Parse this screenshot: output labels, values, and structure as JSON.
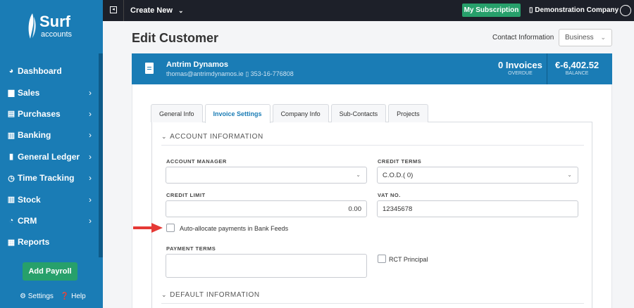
{
  "brand": {
    "name": "Surf",
    "sub": "accounts"
  },
  "sidebar": {
    "items": [
      {
        "label": "Dashboard",
        "icon": "dashboard-icon",
        "glyph": "◕",
        "has_chevron": false
      },
      {
        "label": "Sales",
        "icon": "briefcase-icon",
        "glyph": "▆",
        "has_chevron": true
      },
      {
        "label": "Purchases",
        "icon": "cart-icon",
        "glyph": "▤",
        "has_chevron": true
      },
      {
        "label": "Banking",
        "icon": "bank-icon",
        "glyph": "▥",
        "has_chevron": true
      },
      {
        "label": "General Ledger",
        "icon": "book-icon",
        "glyph": "▮",
        "has_chevron": true
      },
      {
        "label": "Time Tracking",
        "icon": "clock-icon",
        "glyph": "◷",
        "has_chevron": true
      },
      {
        "label": "Stock",
        "icon": "stock-chart-icon",
        "glyph": "▥",
        "has_chevron": true
      },
      {
        "label": "CRM",
        "icon": "pie-chart-icon",
        "glyph": "◔",
        "has_chevron": true
      },
      {
        "label": "Reports",
        "icon": "table-icon",
        "glyph": "▦",
        "has_chevron": false
      }
    ],
    "payroll_button": "Add Payroll",
    "settings_label": "Settings",
    "help_label": "Help"
  },
  "topbar": {
    "create_new": "Create New",
    "subscription_button": "My Subscription",
    "company": "Demonstration Company"
  },
  "page": {
    "title": "Edit Customer",
    "contact_info_label": "Contact Information",
    "contact_info_value": "Business"
  },
  "customer": {
    "name": "Antrim Dynamos",
    "email": "thomas@antrimdynamos.ie",
    "phone": "353-16-776808",
    "invoices_value": "0 Invoices",
    "invoices_caption": "OVERDUE",
    "balance_value": "€-6,402.52",
    "balance_caption": "BALANCE"
  },
  "tabs": [
    {
      "label": "General Info",
      "active": false
    },
    {
      "label": "Invoice Settings",
      "active": true
    },
    {
      "label": "Company Info",
      "active": false
    },
    {
      "label": "Sub-Contacts",
      "active": false
    },
    {
      "label": "Projects",
      "active": false
    }
  ],
  "account_section": {
    "title": "ACCOUNT INFORMATION",
    "account_manager_label": "ACCOUNT MANAGER",
    "account_manager_value": "",
    "credit_terms_label": "CREDIT TERMS",
    "credit_terms_value": "C.O.D.( 0)",
    "credit_limit_label": "CREDIT LIMIT",
    "credit_limit_value": "0.00",
    "vat_label": "VAT NO.",
    "vat_value": "12345678",
    "auto_allocate_label": "Auto-allocate payments in Bank Feeds",
    "auto_allocate_checked": false,
    "payment_terms_label": "PAYMENT TERMS",
    "payment_terms_value": "",
    "rct_label": "RCT Principal",
    "rct_checked": false
  },
  "default_section": {
    "title": "DEFAULT INFORMATION"
  },
  "colors": {
    "brand_blue": "#1a7cb5",
    "green": "#27a06b",
    "topbar": "#1d2029",
    "arrow_red": "#e53935"
  }
}
